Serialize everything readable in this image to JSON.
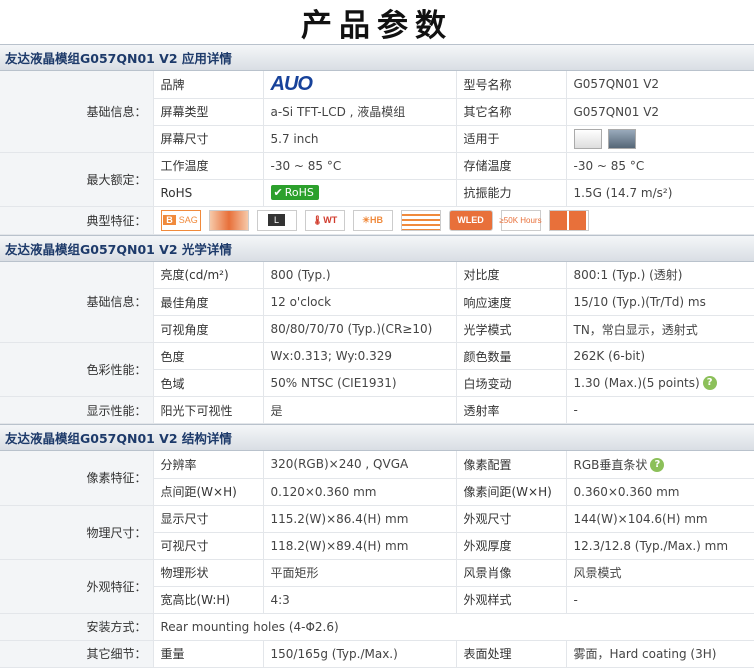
{
  "page_title": "产品参数",
  "sections": {
    "app": {
      "title": "友达液晶模组G057QN01 V2 应用详情"
    },
    "optical": {
      "title": "友达液晶模组G057QN01 V2 光学详情"
    },
    "structure": {
      "title": "友达液晶模组G057QN01 V2 结构详情"
    }
  },
  "app": {
    "basic": "基础信息：",
    "brand_label": "品牌",
    "brand_logo": "AUO",
    "model_label": "型号名称",
    "model_value": "G057QN01 V2",
    "screen_type_label": "屏幕类型",
    "screen_type_value": "a-Si TFT-LCD , 液晶模组",
    "other_name_label": "其它名称",
    "other_name_value": "G057QN01 V2",
    "screen_size_label": "屏幕尺寸",
    "screen_size_value": "5.7 inch",
    "suitable_label": "适用于",
    "max_rating": "最大额定：",
    "op_temp_label": "工作温度",
    "op_temp_value": "-30 ~ 85 °C",
    "storage_temp_label": "存储温度",
    "storage_temp_value": "-30 ~ 85 °C",
    "rohs_label": "RoHS",
    "rohs_badge": "RoHS",
    "vibration_label": "抗振能力",
    "vibration_value": "1.5G (14.7 m/s²)",
    "features_label": "典型特征：",
    "feature_badges": [
      "SAG",
      "",
      "L",
      "WT",
      "HB",
      "",
      "WLED",
      "≥50K Hours",
      ""
    ]
  },
  "optical": {
    "basic": "基础信息：",
    "brightness_label": "亮度(cd/m²)",
    "brightness_value": "800 (Typ.)",
    "contrast_label": "对比度",
    "contrast_value": "800:1 (Typ.) (透射)",
    "best_angle_label": "最佳角度",
    "best_angle_value": "12 o'clock",
    "response_label": "响应速度",
    "response_value": "15/10 (Typ.)(Tr/Td) ms",
    "view_angle_label": "可视角度",
    "view_angle_value": "80/80/70/70 (Typ.)(CR≥10)",
    "optical_mode_label": "光学模式",
    "optical_mode_value": "TN，常白显示，透射式",
    "color": "色彩性能：",
    "chroma_label": "色度",
    "chroma_value": "Wx:0.313; Wy:0.329",
    "color_count_label": "颜色数量",
    "color_count_value": "262K (6-bit)",
    "gamut_label": "色域",
    "gamut_value": "50% NTSC (CIE1931)",
    "white_var_label": "白场变动",
    "white_var_value": "1.30 (Max.)(5 points)",
    "display": "显示性能：",
    "sunlight_label": "阳光下可视性",
    "sunlight_value": "是",
    "haze_label": "透射率",
    "haze_value": "-"
  },
  "structure": {
    "pixel": "像素特征：",
    "resolution_label": "分辨率",
    "resolution_value": "320(RGB)×240 , QVGA",
    "pixel_config_label": "像素配置",
    "pixel_config_value": "RGB垂直条状",
    "dot_pitch_label": "点间距(W×H)",
    "dot_pitch_value": "0.120×0.360 mm",
    "pixel_pitch_label": "像素间距(W×H)",
    "pixel_pitch_value": "0.360×0.360 mm",
    "physical": "物理尺寸：",
    "display_size_label": "显示尺寸",
    "display_size_value": "115.2(W)×86.4(H) mm",
    "outline_label": "外观尺寸",
    "outline_value": "144(W)×104.6(H) mm",
    "view_size_label": "可视尺寸",
    "view_size_value": "118.2(W)×89.4(H) mm",
    "thickness_label": "外观厚度",
    "thickness_value": "12.3/12.8 (Typ./Max.) mm",
    "appearance": "外观特征：",
    "shape_label": "物理形状",
    "shape_value": "平面矩形",
    "style_label": "风景肖像",
    "style_value": "风景模式",
    "aspect_label": "宽高比(W:H)",
    "aspect_value": "4:3",
    "look_label": "外观样式",
    "look_value": "-",
    "mount": "安装方式：",
    "mount_value": "Rear mounting holes (4-Φ2.6)",
    "other": "其它细节：",
    "weight_label": "重量",
    "weight_value": "150/165g (Typ./Max.)",
    "surface_label": "表面处理",
    "surface_value": "雾面，Hard coating (3H)"
  },
  "colors": {
    "section_title": "#1d3a6a",
    "brand_blue": "#17429a",
    "rohs_green": "#2ca02c",
    "help_green": "#8cc05a"
  }
}
